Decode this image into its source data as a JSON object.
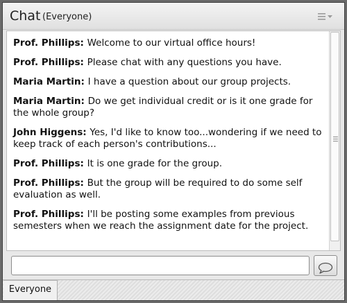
{
  "pod": {
    "title": "Chat",
    "subtitle": "(Everyone)",
    "menu_icon": "pod-menu-icon"
  },
  "messages": [
    {
      "sender": "Prof. Phillips",
      "text": "Welcome to our virtual office hours!"
    },
    {
      "sender": "Prof. Phillips",
      "text": "Please chat with any questions you have."
    },
    {
      "sender": "Maria Martin",
      "text": "I have a question about our group projects."
    },
    {
      "sender": "Maria Martin",
      "text": "Do we get individual credit or is it one grade for the whole group?"
    },
    {
      "sender": "John Higgens",
      "text": "Yes, I'd like to know too...wondering if we need to keep track of each person's contributions..."
    },
    {
      "sender": "Prof. Phillips",
      "text": "It is one grade for the group."
    },
    {
      "sender": "Prof. Phillips",
      "text": "But the group will be required to do some self evaluation as well."
    },
    {
      "sender": "Prof. Phillips",
      "text": "I'll be posting some examples from previous semesters when we reach the assignment date for the project."
    }
  ],
  "input": {
    "value": "",
    "placeholder": "",
    "send_icon": "speech-bubble-icon"
  },
  "tabs": [
    {
      "label": "Everyone"
    }
  ]
}
